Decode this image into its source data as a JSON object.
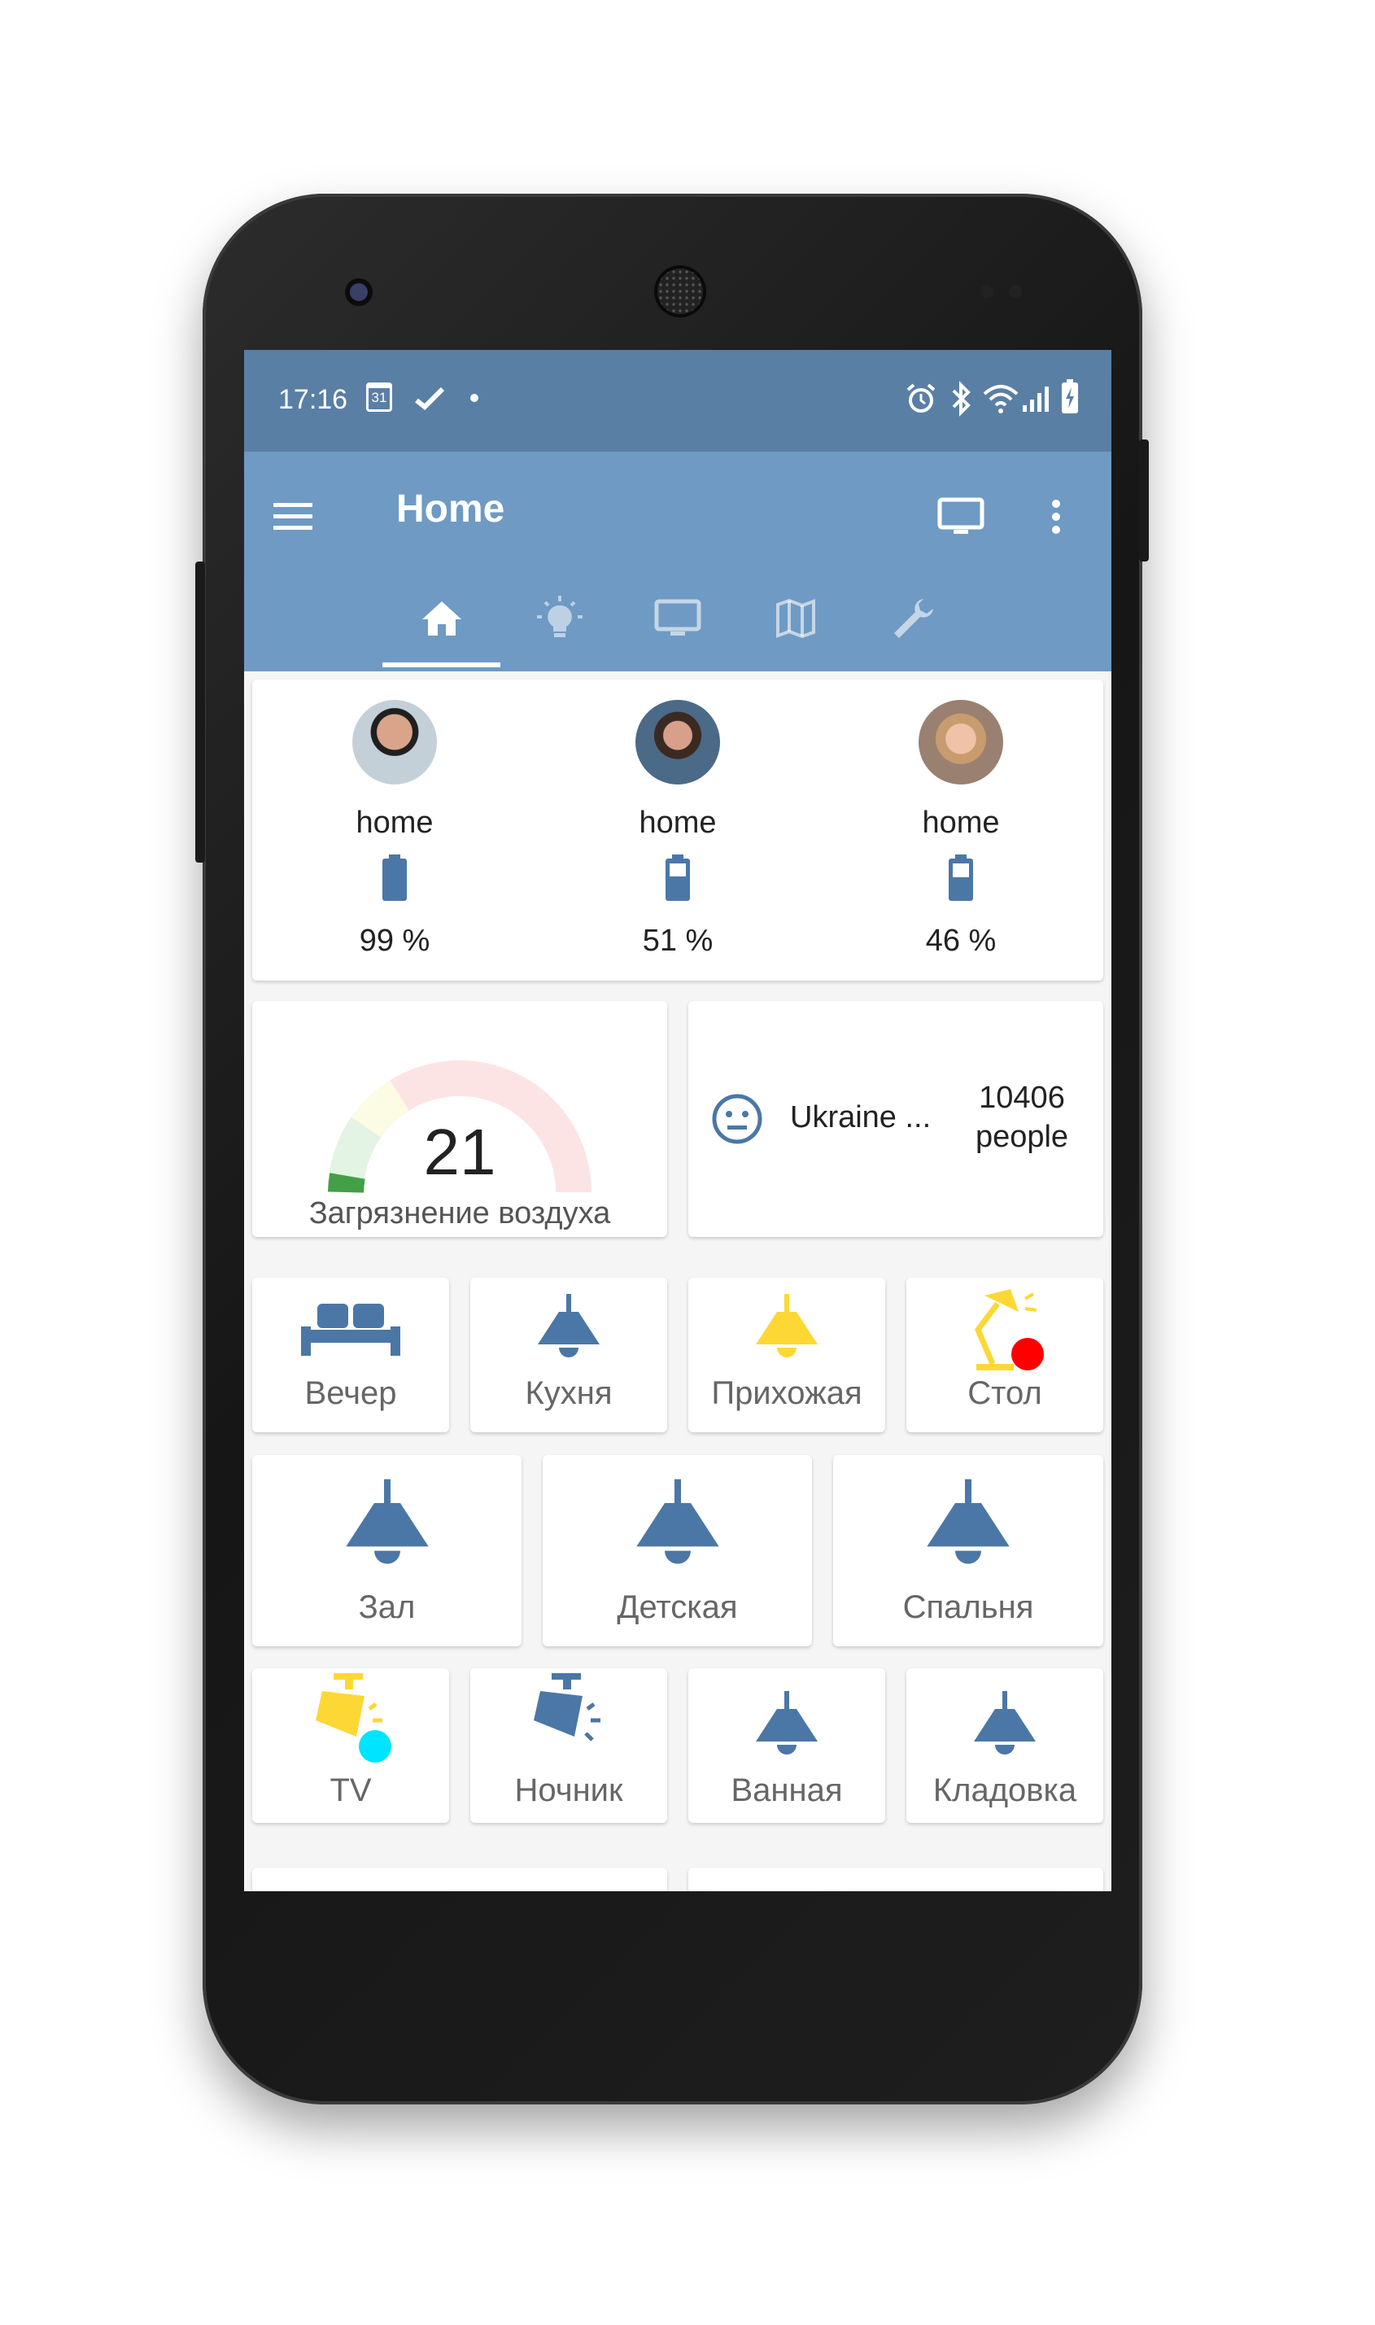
{
  "status": {
    "time": "17:16",
    "calendar_day": "31",
    "icons": [
      "calendar-icon",
      "check-icon",
      "dot-icon",
      "alarm-icon",
      "bluetooth-icon",
      "wifi-icon",
      "signal-icon",
      "battery-charging-icon"
    ]
  },
  "appbar": {
    "title": "Home",
    "tabs": [
      {
        "name": "home-icon",
        "active": true
      },
      {
        "name": "lightbulb-icon",
        "active": false
      },
      {
        "name": "monitor-icon",
        "active": false
      },
      {
        "name": "map-icon",
        "active": false
      },
      {
        "name": "wrench-icon",
        "active": false
      }
    ]
  },
  "people": [
    {
      "location": "home",
      "battery": "99 %"
    },
    {
      "location": "home",
      "battery": "51 %"
    },
    {
      "location": "home",
      "battery": "46 %"
    }
  ],
  "air": {
    "value": "21",
    "label": "Загрязнение воздуха"
  },
  "covid": {
    "country": "Ukraine ...",
    "count": "10406",
    "unit": "people"
  },
  "tiles_row1": [
    {
      "label": "Вечер",
      "icon": "sofa-icon",
      "color": "#4b77a6"
    },
    {
      "label": "Кухня",
      "icon": "ceiling-lamp-icon",
      "color": "#4b77a6"
    },
    {
      "label": "Прихожая",
      "icon": "ceiling-lamp-icon",
      "color": "#fdd835"
    },
    {
      "label": "Стол",
      "icon": "desk-lamp-icon",
      "color": "#fdd835"
    }
  ],
  "tiles_row2": [
    {
      "label": "Зал",
      "icon": "ceiling-lamp-icon",
      "color": "#4b77a6"
    },
    {
      "label": "Детская",
      "icon": "ceiling-lamp-icon",
      "color": "#4b77a6"
    },
    {
      "label": "Спальня",
      "icon": "ceiling-lamp-icon",
      "color": "#4b77a6"
    }
  ],
  "tiles_row3": [
    {
      "label": "TV",
      "icon": "spotlight-icon",
      "color": "#fdd835"
    },
    {
      "label": "Ночник",
      "icon": "spotlight-icon",
      "color": "#4b77a6"
    },
    {
      "label": "Ванная",
      "icon": "ceiling-lamp-icon",
      "color": "#4b77a6"
    },
    {
      "label": "Кладовка",
      "icon": "ceiling-lamp-icon",
      "color": "#4b77a6"
    }
  ],
  "colors": {
    "primary": "#6f9ac4",
    "status": "#5a7fa5",
    "accent_blue": "#4b77a6",
    "accent_yellow": "#fdd835",
    "dot_red": "#ff0000",
    "dot_cyan": "#00e5ff"
  }
}
